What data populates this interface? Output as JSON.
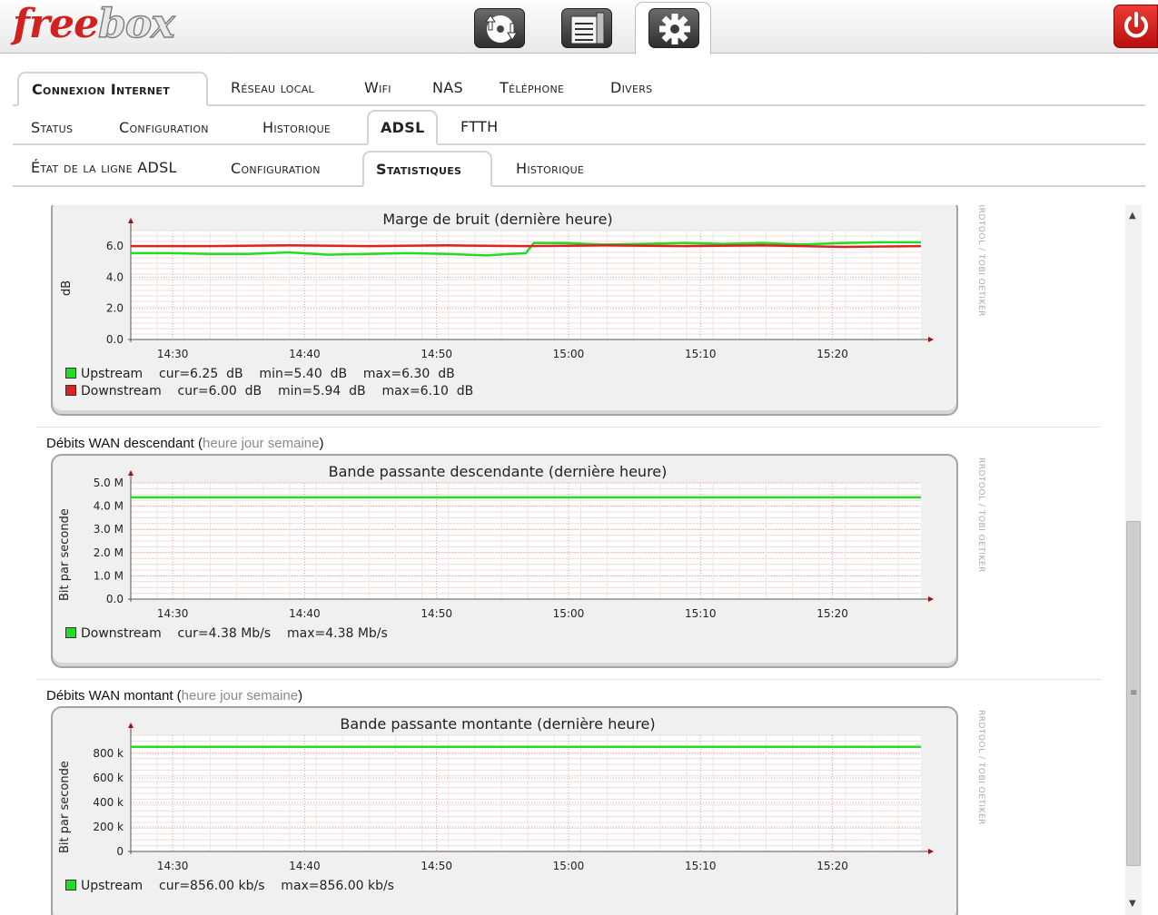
{
  "header": {
    "logo_free": "free",
    "logo_box": "box",
    "buttons": [
      {
        "name": "downloads-icon"
      },
      {
        "name": "file-manager-icon"
      },
      {
        "name": "settings-gear-icon"
      },
      {
        "name": "power-icon"
      }
    ]
  },
  "tabs_main": [
    {
      "label": "Connexion Internet",
      "active": true
    },
    {
      "label": "Réseau local",
      "active": false
    },
    {
      "label": "Wifi",
      "active": false
    },
    {
      "label": "NAS",
      "active": false
    },
    {
      "label": "Téléphone",
      "active": false
    },
    {
      "label": "Divers",
      "active": false
    }
  ],
  "tabs_sub": [
    {
      "label": "Status",
      "active": false
    },
    {
      "label": "Configuration",
      "active": false
    },
    {
      "label": "Historique",
      "active": false
    },
    {
      "label": "ADSL",
      "active": true
    },
    {
      "label": "FTTH",
      "active": false
    }
  ],
  "tabs_adsl": [
    {
      "label": "État de la ligne ADSL",
      "active": false
    },
    {
      "label": "Configuration",
      "active": false
    },
    {
      "label": "Statistiques",
      "active": true
    },
    {
      "label": "Historique",
      "active": false
    }
  ],
  "sections": {
    "down": {
      "title": "Débits WAN descendant",
      "open": " (",
      "links": [
        "heure",
        "jour",
        "semaine"
      ],
      "close": ")"
    },
    "up": {
      "title": "Débits WAN montant",
      "open": " (",
      "links": [
        "heure",
        "jour",
        "semaine"
      ],
      "close": ")"
    }
  },
  "watermark": "RRDTOOL / TOBI OETIKER",
  "colors": {
    "upstream": "#22dd22",
    "downstream": "#dd2222",
    "accent": "#d0231f"
  },
  "chart_data": [
    {
      "type": "line",
      "title": "Marge de bruit (dernière heure)",
      "ylabel": "dB",
      "yticks": [
        "0.0",
        "2.0",
        "4.0",
        "6.0"
      ],
      "ylim": [
        0,
        7
      ],
      "xticks": [
        "14:30",
        "14:40",
        "14:50",
        "15:00",
        "15:10",
        "15:20"
      ],
      "series": [
        {
          "name": "Upstream",
          "color": "#22dd22",
          "cur": "6.25",
          "min": "5.40",
          "max": "6.30",
          "unit": "dB",
          "points": [
            [
              0,
              5.55
            ],
            [
              5,
              5.55
            ],
            [
              10,
              5.5
            ],
            [
              15,
              5.5
            ],
            [
              20,
              5.6
            ],
            [
              25,
              5.45
            ],
            [
              30,
              5.5
            ],
            [
              35,
              5.55
            ],
            [
              40,
              5.5
            ],
            [
              45,
              5.4
            ],
            [
              48,
              5.5
            ],
            [
              50,
              5.55
            ],
            [
              51,
              6.2
            ],
            [
              55,
              6.2
            ],
            [
              60,
              6.1
            ],
            [
              65,
              6.15
            ],
            [
              70,
              6.2
            ],
            [
              75,
              6.15
            ],
            [
              80,
              6.2
            ],
            [
              85,
              6.1
            ],
            [
              90,
              6.2
            ],
            [
              95,
              6.25
            ],
            [
              100,
              6.25
            ]
          ]
        },
        {
          "name": "Downstream",
          "color": "#dd2222",
          "cur": "6.00",
          "min": "5.94",
          "max": "6.10",
          "unit": "dB",
          "points": [
            [
              0,
              6.0
            ],
            [
              10,
              6.0
            ],
            [
              20,
              6.05
            ],
            [
              30,
              6.0
            ],
            [
              40,
              6.05
            ],
            [
              50,
              6.0
            ],
            [
              60,
              6.05
            ],
            [
              70,
              6.0
            ],
            [
              80,
              6.05
            ],
            [
              90,
              5.95
            ],
            [
              100,
              6.0
            ]
          ]
        }
      ],
      "legend": [
        {
          "label": "Upstream",
          "text": "    cur=6.25  dB    min=5.40  dB    max=6.30  dB"
        },
        {
          "label": "Downstream",
          "text": "    cur=6.00  dB    min=5.94  dB    max=6.10  dB"
        }
      ]
    },
    {
      "type": "line",
      "title": "Bande passante descendante (dernière heure)",
      "ylabel": "Bit par seconde",
      "yticks": [
        "0.0",
        "1.0 M",
        "2.0 M",
        "3.0 M",
        "4.0 M",
        "5.0 M"
      ],
      "ylim": [
        0,
        5
      ],
      "xticks": [
        "14:30",
        "14:40",
        "14:50",
        "15:00",
        "15:10",
        "15:20"
      ],
      "series": [
        {
          "name": "Downstream",
          "color": "#22dd22",
          "cur": "4.38 Mb/s",
          "max": "4.38 Mb/s",
          "points": [
            [
              0,
              4.38
            ],
            [
              100,
              4.38
            ]
          ]
        }
      ],
      "legend": [
        {
          "label": "Downstream",
          "text": "    cur=4.38 Mb/s    max=4.38 Mb/s"
        }
      ]
    },
    {
      "type": "line",
      "title": "Bande passante montante (dernière heure)",
      "ylabel": "Bit par seconde",
      "yticks": [
        "0",
        "200 k",
        "400 k",
        "600 k",
        "800 k"
      ],
      "ylim": [
        0,
        950
      ],
      "xticks": [
        "14:30",
        "14:40",
        "14:50",
        "15:00",
        "15:10",
        "15:20"
      ],
      "series": [
        {
          "name": "Upstream",
          "color": "#22dd22",
          "cur": "856.00 kb/s",
          "max": "856.00 kb/s",
          "points": [
            [
              0,
              856
            ],
            [
              100,
              856
            ]
          ]
        }
      ],
      "legend": [
        {
          "label": "Upstream",
          "text": "    cur=856.00 kb/s    max=856.00 kb/s"
        }
      ]
    }
  ]
}
